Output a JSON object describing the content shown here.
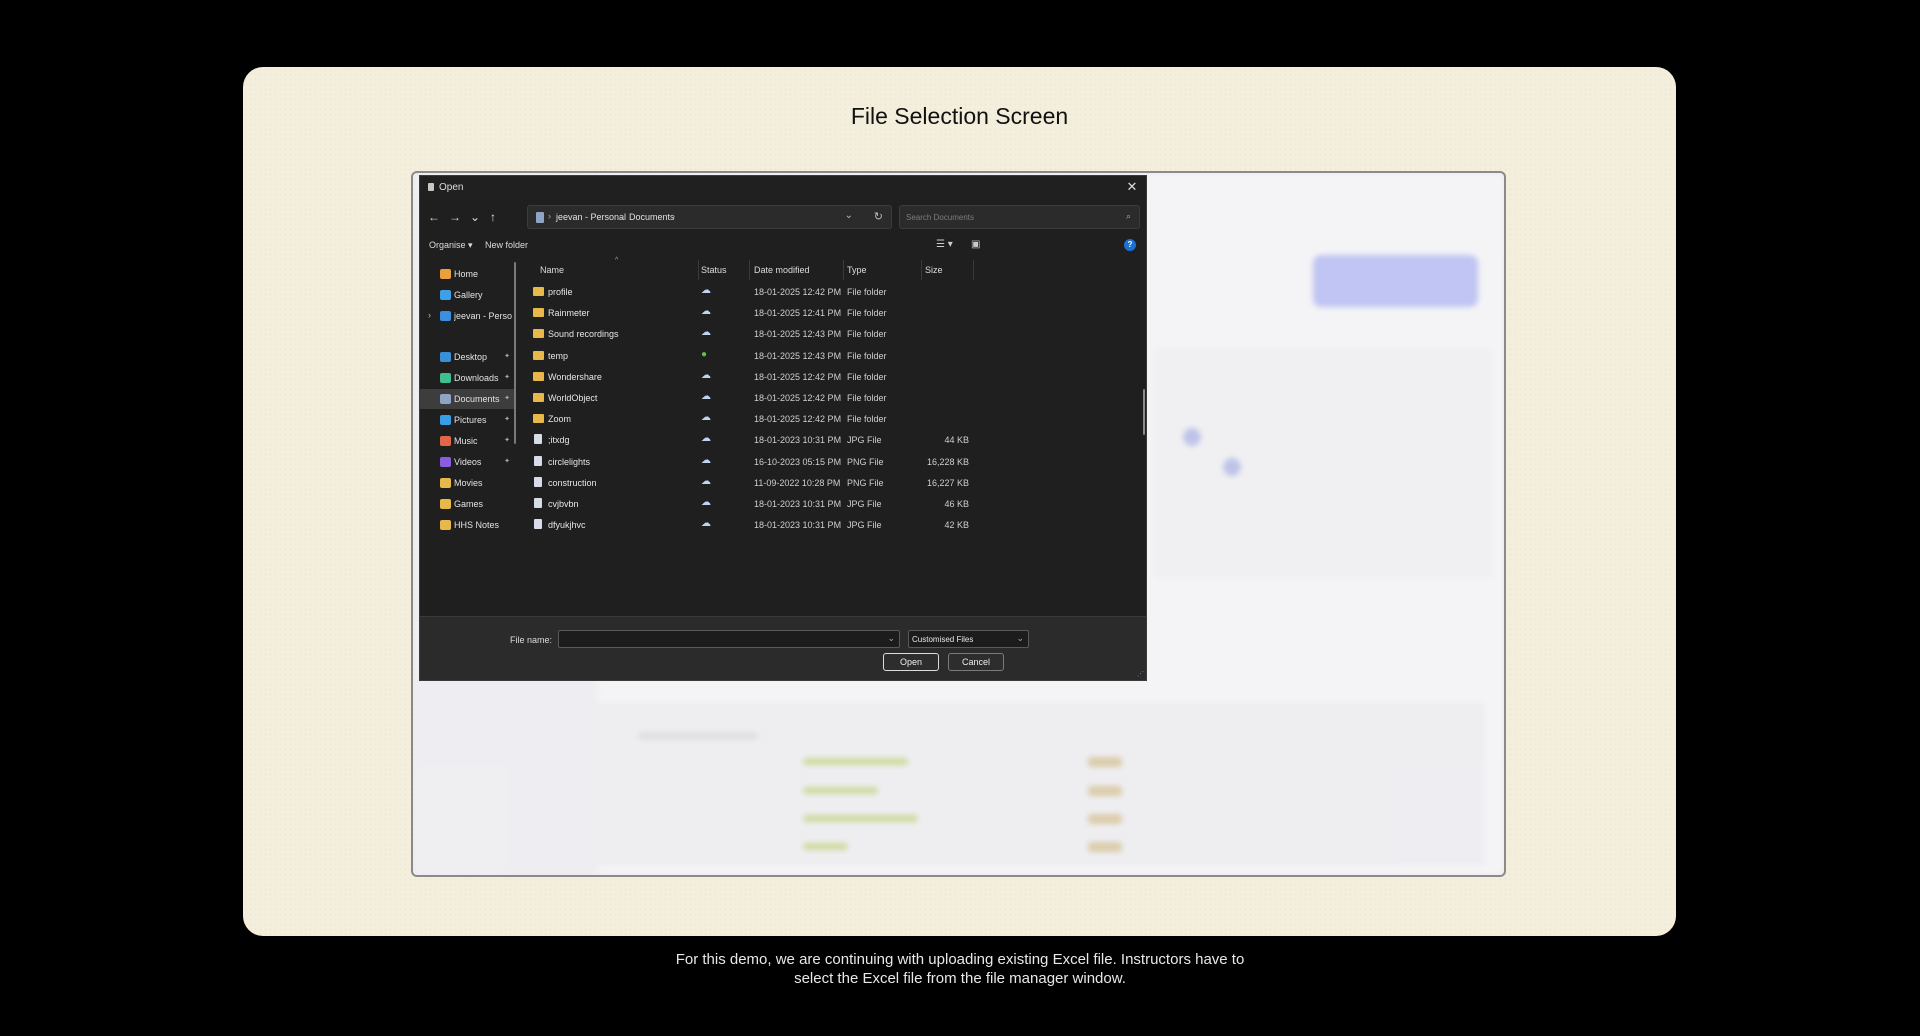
{
  "slide": {
    "title": "File Selection Screen",
    "caption_line1": "For this demo, we are continuing with uploading existing Excel file. Instructors have to",
    "caption_line2": "select the Excel file from the file manager window."
  },
  "dialog": {
    "title": "Open",
    "close_glyph": "✕",
    "nav": {
      "back": "←",
      "forward": "→",
      "recent": "⌄",
      "up": "↑"
    },
    "breadcrumb": [
      "jeevan - Personal",
      "Documents"
    ],
    "breadcrumb_sep": "›",
    "refresh_glyph": "↻",
    "dropdown_glyph": "⌄",
    "search_placeholder": "Search Documents",
    "search_icon": "⌕",
    "commands": {
      "organise": "Organise ▾",
      "new_folder": "New folder",
      "help": "?"
    },
    "columns": {
      "name": "Name",
      "status": "Status",
      "date": "Date modified",
      "type": "Type",
      "size": "Size"
    },
    "nav_pane": [
      {
        "label": "Home",
        "icon": "home-icon",
        "color": "#e9a13b",
        "pin": false
      },
      {
        "label": "Gallery",
        "icon": "gallery-icon",
        "color": "#3ea0e8",
        "pin": false
      },
      {
        "label": "jeevan - Persona",
        "icon": "cloud-icon",
        "color": "#3b8fe0",
        "pin": false,
        "expander": "›"
      },
      {
        "label": "Desktop",
        "icon": "desktop-icon",
        "color": "#3a8fd9",
        "pin": true
      },
      {
        "label": "Downloads",
        "icon": "downloads-icon",
        "color": "#3fbf8f",
        "pin": true
      },
      {
        "label": "Documents",
        "icon": "documents-icon",
        "color": "#8fa3c4",
        "pin": true,
        "active": true
      },
      {
        "label": "Pictures",
        "icon": "pictures-icon",
        "color": "#3a9ee6",
        "pin": true
      },
      {
        "label": "Music",
        "icon": "music-icon",
        "color": "#e2674a",
        "pin": true
      },
      {
        "label": "Videos",
        "icon": "videos-icon",
        "color": "#8a5de0",
        "pin": true
      },
      {
        "label": "Movies",
        "icon": "folder-icon",
        "color": "#e8b84a",
        "pin": false
      },
      {
        "label": "Games",
        "icon": "folder-icon",
        "color": "#e8b84a",
        "pin": false
      },
      {
        "label": "HHS Notes",
        "icon": "folder-icon",
        "color": "#e8b84a",
        "pin": false
      }
    ],
    "pin_glyph": "📌",
    "files": [
      {
        "name": "profile",
        "kind": "folder",
        "status": "cloud",
        "date": "18-01-2025 12:42 PM",
        "type": "File folder",
        "size": ""
      },
      {
        "name": "Rainmeter",
        "kind": "folder",
        "status": "cloud",
        "date": "18-01-2025 12:41 PM",
        "type": "File folder",
        "size": ""
      },
      {
        "name": "Sound recordings",
        "kind": "folder",
        "status": "cloud",
        "date": "18-01-2025 12:43 PM",
        "type": "File folder",
        "size": ""
      },
      {
        "name": "temp",
        "kind": "folder",
        "status": "ok",
        "date": "18-01-2025 12:43 PM",
        "type": "File folder",
        "size": ""
      },
      {
        "name": "Wondershare",
        "kind": "folder",
        "status": "cloud",
        "date": "18-01-2025 12:42 PM",
        "type": "File folder",
        "size": ""
      },
      {
        "name": "WorldObject",
        "kind": "folder",
        "status": "cloud",
        "date": "18-01-2025 12:42 PM",
        "type": "File folder",
        "size": ""
      },
      {
        "name": "Zoom",
        "kind": "folder",
        "status": "cloud",
        "date": "18-01-2025 12:42 PM",
        "type": "File folder",
        "size": ""
      },
      {
        "name": ";itxdg",
        "kind": "file",
        "status": "cloud",
        "date": "18-01-2023 10:31 PM",
        "type": "JPG File",
        "size": "44 KB"
      },
      {
        "name": "circlelights",
        "kind": "file",
        "status": "cloud",
        "date": "16-10-2023 05:15 PM",
        "type": "PNG File",
        "size": "16,228 KB"
      },
      {
        "name": "construction",
        "kind": "file",
        "status": "cloud",
        "date": "11-09-2022 10:28 PM",
        "type": "PNG File",
        "size": "16,227 KB"
      },
      {
        "name": "cvjbvbn",
        "kind": "file",
        "status": "cloud",
        "date": "18-01-2023 10:31 PM",
        "type": "JPG File",
        "size": "46 KB"
      },
      {
        "name": "dfyukjhvc",
        "kind": "file",
        "status": "cloud",
        "date": "18-01-2023 10:31 PM",
        "type": "JPG File",
        "size": "42 KB"
      }
    ],
    "status_glyphs": {
      "cloud": "☁",
      "ok": "●"
    },
    "filename_label": "File name:",
    "filename_value": "",
    "filter_value": "Customised Files",
    "open_label": "Open",
    "cancel_label": "Cancel"
  }
}
